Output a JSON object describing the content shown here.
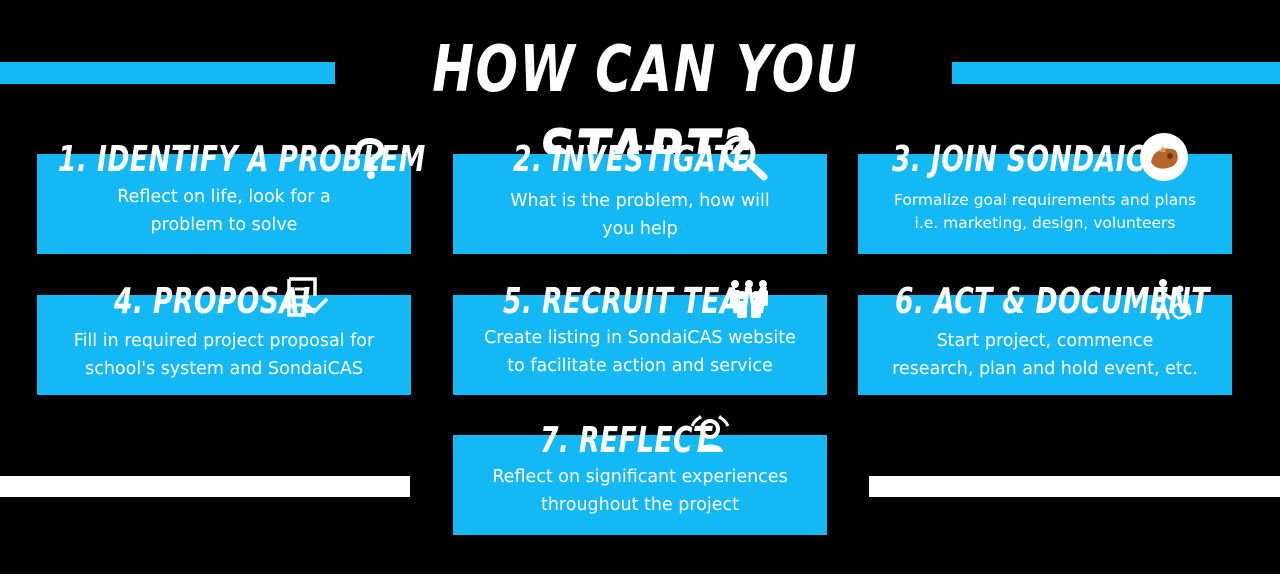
{
  "title": "HOW CAN YOU START?",
  "colors": {
    "accent": "#14b8f5",
    "background": "#000000",
    "text": "#ffffff"
  },
  "steps": [
    {
      "heading": "1. IDENTIFY A PROBLEM",
      "icon": "question-icon",
      "lines": [
        "Reflect on life, look for a",
        "problem to solve"
      ]
    },
    {
      "heading": "2. INVESTIGATE",
      "icon": "magnifier-icon",
      "lines": [
        "What is the problem, how will",
        "you help"
      ]
    },
    {
      "heading": "3. JOIN SONDAICAS",
      "icon": "sondaicas-logo-icon",
      "lines": [
        "Formalize goal requirements and plans",
        "i.e. marketing, design, volunteers"
      ]
    },
    {
      "heading": "4. PROPOSAL",
      "icon": "checklist-document-icon",
      "lines": [
        "Fill in required project proposal for",
        "school's system and SondaiCAS"
      ]
    },
    {
      "heading": "5. RECRUIT TEAM",
      "icon": "team-icon",
      "lines": [
        "Create listing in SondaiCAS website",
        "to facilitate action and service"
      ]
    },
    {
      "heading": "6. ACT & DOCUMENT",
      "icon": "helping-person-icon",
      "lines": [
        "Start project, commence",
        "research, plan and hold event, etc."
      ]
    },
    {
      "heading": "7. REFLECT",
      "icon": "reflect-person-icon",
      "lines": [
        "Reflect on significant experiences",
        "throughout the project"
      ]
    }
  ]
}
